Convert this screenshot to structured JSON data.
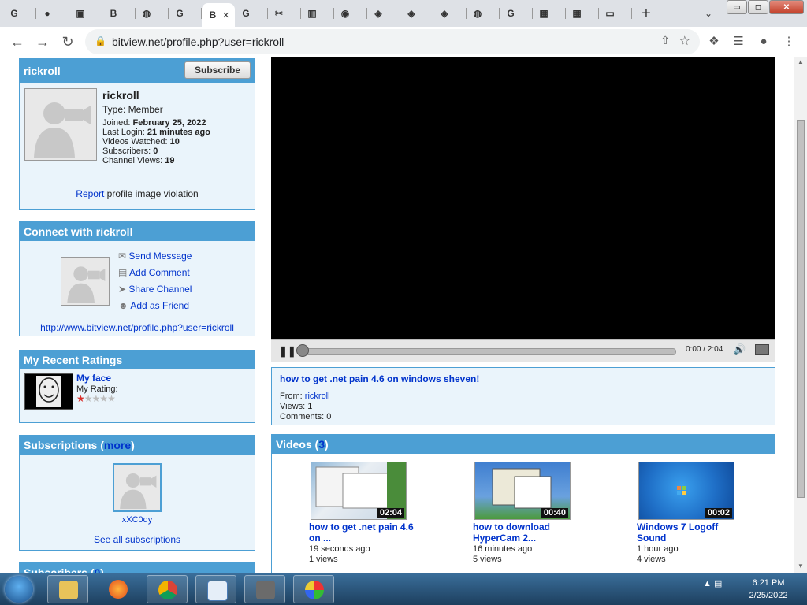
{
  "browser": {
    "tabs": [
      {
        "icon": "google-icon",
        "glyph": "G"
      },
      {
        "icon": "github-icon",
        "glyph": "●"
      },
      {
        "icon": "folder-tab-icon",
        "glyph": "▣"
      },
      {
        "icon": "bitview-tab-icon",
        "glyph": "B"
      },
      {
        "icon": "globe-tab-icon",
        "glyph": "◍"
      },
      {
        "icon": "google-icon",
        "glyph": "G"
      },
      {
        "icon": "bitview-tab-icon",
        "glyph": "B",
        "active": true
      },
      {
        "icon": "google-icon",
        "glyph": "G"
      },
      {
        "icon": "scissors-tab-icon",
        "glyph": "✂"
      },
      {
        "icon": "archive-tab-icon",
        "glyph": "▥"
      },
      {
        "icon": "chrome-tab-icon",
        "glyph": "◉"
      },
      {
        "icon": "webcam-tab-icon",
        "glyph": "◈"
      },
      {
        "icon": "webcam-tab-icon",
        "glyph": "◈"
      },
      {
        "icon": "webcam-tab-icon",
        "glyph": "◈"
      },
      {
        "icon": "globe-tab-icon",
        "glyph": "◍"
      },
      {
        "icon": "google-icon",
        "glyph": "G"
      },
      {
        "icon": "microsoft-tab-icon",
        "glyph": "▦"
      },
      {
        "icon": "microsoft-tab-icon",
        "glyph": "▦"
      },
      {
        "icon": "site-tab-icon",
        "glyph": "▭"
      }
    ],
    "new_tab_glyph": "+",
    "tab_search_glyph": "⌄",
    "url": "bitview.net/profile.php?user=rickroll",
    "window_controls": {
      "minimize": "▭",
      "maximize": "◻",
      "close": "✕"
    }
  },
  "profile": {
    "header": "rickroll",
    "subscribe_label": "Subscribe",
    "name": "rickroll",
    "type": "Type: Member",
    "joined_label": "Joined:",
    "joined_value": "February 25, 2022",
    "login_label": "Last Login:",
    "login_value": "21 minutes ago",
    "watched_label": "Videos Watched:",
    "watched_value": "10",
    "subs_label": "Subscribers:",
    "subs_value": "0",
    "views_label": "Channel Views:",
    "views_value": "19",
    "report_link": "Report",
    "report_text": "profile image violation"
  },
  "connect": {
    "header": "Connect with rickroll",
    "actions": [
      "Send Message",
      "Add Comment",
      "Share Channel",
      "Add as Friend"
    ],
    "url": "http://www.bitview.net/profile.php?user=rickroll"
  },
  "ratings": {
    "header": "My Recent Ratings",
    "title": "My face",
    "label": "My Rating:",
    "stars": 1,
    "max_stars": 5
  },
  "subscriptions": {
    "header": "Subscriptions (",
    "more": "more",
    "header_end": ")",
    "user": "xXC0dy",
    "see_all": "See all subscriptions"
  },
  "subscribers": {
    "header": "Subscribers (",
    "count": "0",
    "header_end": ")"
  },
  "player": {
    "time": "0:00 / 2:04",
    "progress": 0
  },
  "video": {
    "title": "how to get .net pain 4.6 on windows sheven!",
    "from_label": "From:",
    "from_user": "rickroll",
    "views": "Views: 1",
    "comments": "Comments: 0"
  },
  "videos": {
    "header": "Videos (",
    "count": "3",
    "header_end": ")",
    "items": [
      {
        "title": "how to get .net pain 4.6 on ...",
        "duration": "02:04",
        "age": "19 seconds ago",
        "views": "1 views"
      },
      {
        "title": "how to download HyperCam 2...",
        "duration": "00:40",
        "age": "16 minutes ago",
        "views": "5 views"
      },
      {
        "title": "Windows 7 Logoff Sound",
        "duration": "00:02",
        "age": "1 hour ago",
        "views": "4 views"
      }
    ]
  },
  "taskbar": {
    "apps": [
      "file-explorer",
      "firefox",
      "chrome",
      "wordpad",
      "hypercam",
      "paint"
    ],
    "time": "6:21 PM",
    "date": "2/25/2022"
  },
  "colors": {
    "accent": "#4c9fd4",
    "panel_bg": "#eaf4fb",
    "link": "#0033cc",
    "star_on": "#d9302c",
    "star_off": "#bdbdbd"
  }
}
